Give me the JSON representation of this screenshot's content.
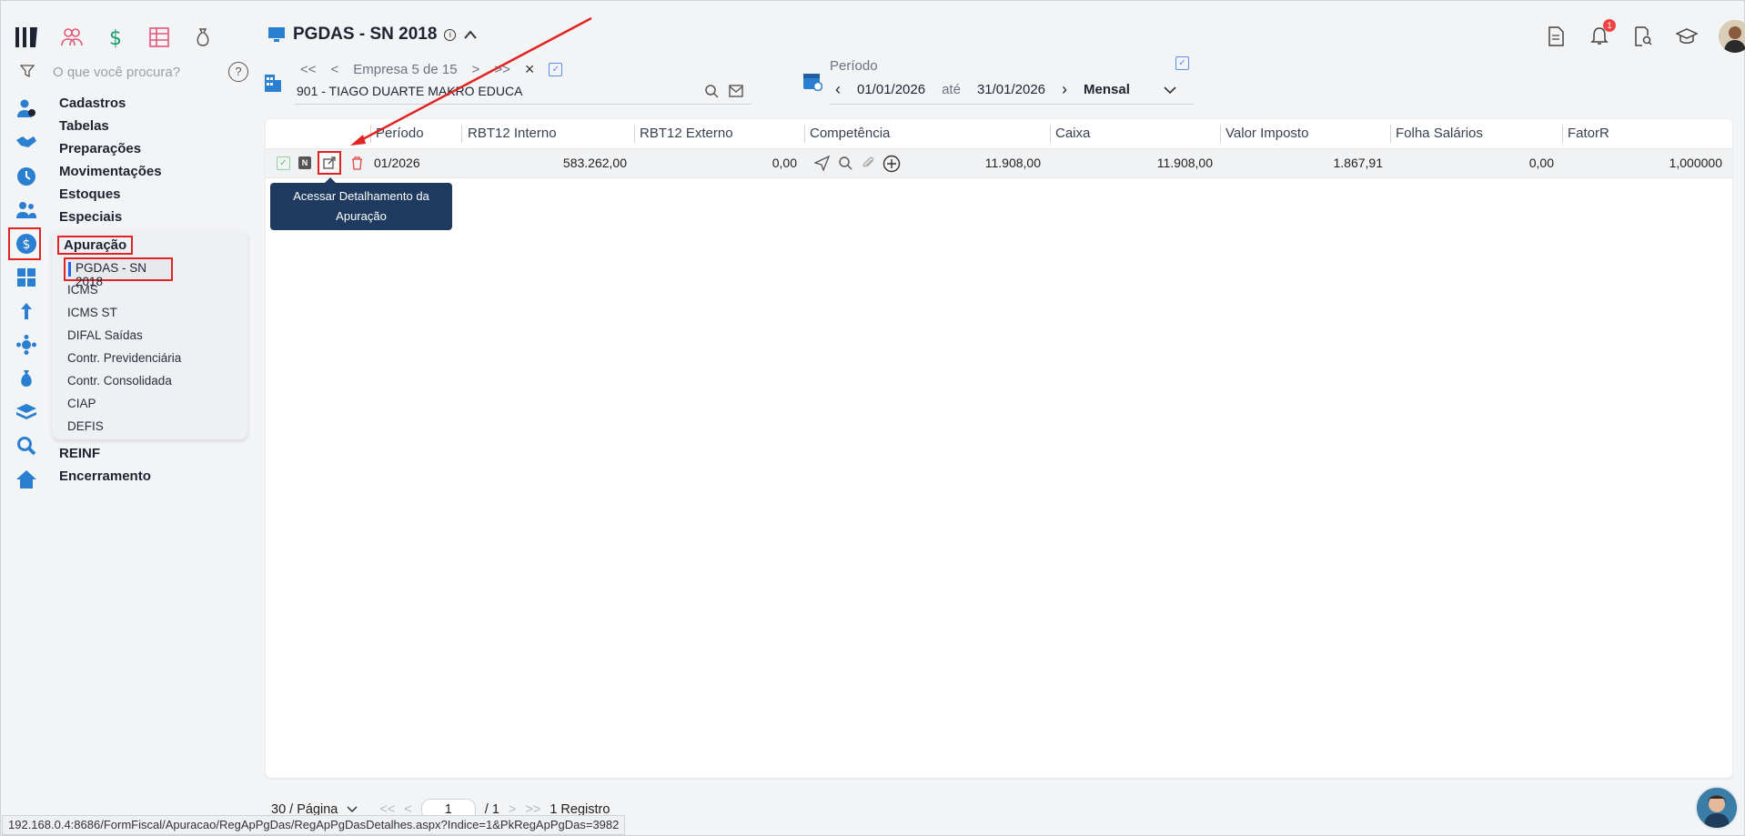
{
  "header": {
    "title": "PGDAS - SN 2018",
    "info_glyph": "i",
    "notification_count": "1"
  },
  "search": {
    "placeholder": "O que você procura?",
    "help_glyph": "?"
  },
  "menu": {
    "items_top": [
      "Cadastros",
      "Tabelas",
      "Preparações",
      "Movimentações",
      "Estoques",
      "Especiais"
    ],
    "apuracao": {
      "label": "Apuração",
      "active": "PGDAS - SN 2018",
      "items": [
        "ICMS",
        "ICMS ST",
        "DIFAL Saídas",
        "Contr. Previdenciária",
        "Contr. Consolidada",
        "CIAP",
        "DEFIS"
      ]
    },
    "items_bottom": [
      "REINF",
      "Encerramento"
    ]
  },
  "empresa": {
    "first": "<<",
    "prev": "<",
    "counter": "Empresa 5 de 15",
    "next": ">",
    "last": ">>",
    "clear": "×",
    "name": "901 - TIAGO DUARTE MAKRO EDUCA"
  },
  "periodo": {
    "label": "Período",
    "start": "01/01/2026",
    "sep": "até",
    "end": "31/01/2026",
    "mode": "Mensal"
  },
  "grid": {
    "columns": [
      "Período",
      "RBT12 Interno",
      "RBT12 Externo",
      "Competência",
      "Caixa",
      "Valor Imposto",
      "Folha Salários",
      "FatorR"
    ],
    "row": {
      "flag": "N",
      "periodo": "01/2026",
      "rbt12_interno": "583.262,00",
      "rbt12_externo": "0,00",
      "competencia": "11.908,00",
      "caixa": "11.908,00",
      "valor_imposto": "1.867,91",
      "folha": "0,00",
      "fator_r": "1,000000"
    },
    "tooltip_line1": "Acessar Detalhamento da",
    "tooltip_line2": "Apuração"
  },
  "footer": {
    "per_page": "30 / Página",
    "first": "<<",
    "prev": "<",
    "page": "1",
    "total": "/ 1",
    "next": ">",
    "last": ">>",
    "records": "1 Registro"
  },
  "status_url": "192.168.0.4:8686/FormFiscal/Apuracao/RegApPgDas/RegApPgDasDetalhes.aspx?Indice=1&PkRegApPgDas=3982",
  "colors": {
    "accent": "#2563eb",
    "highlight": "#e02424",
    "tooltip": "#1e3a5f"
  }
}
